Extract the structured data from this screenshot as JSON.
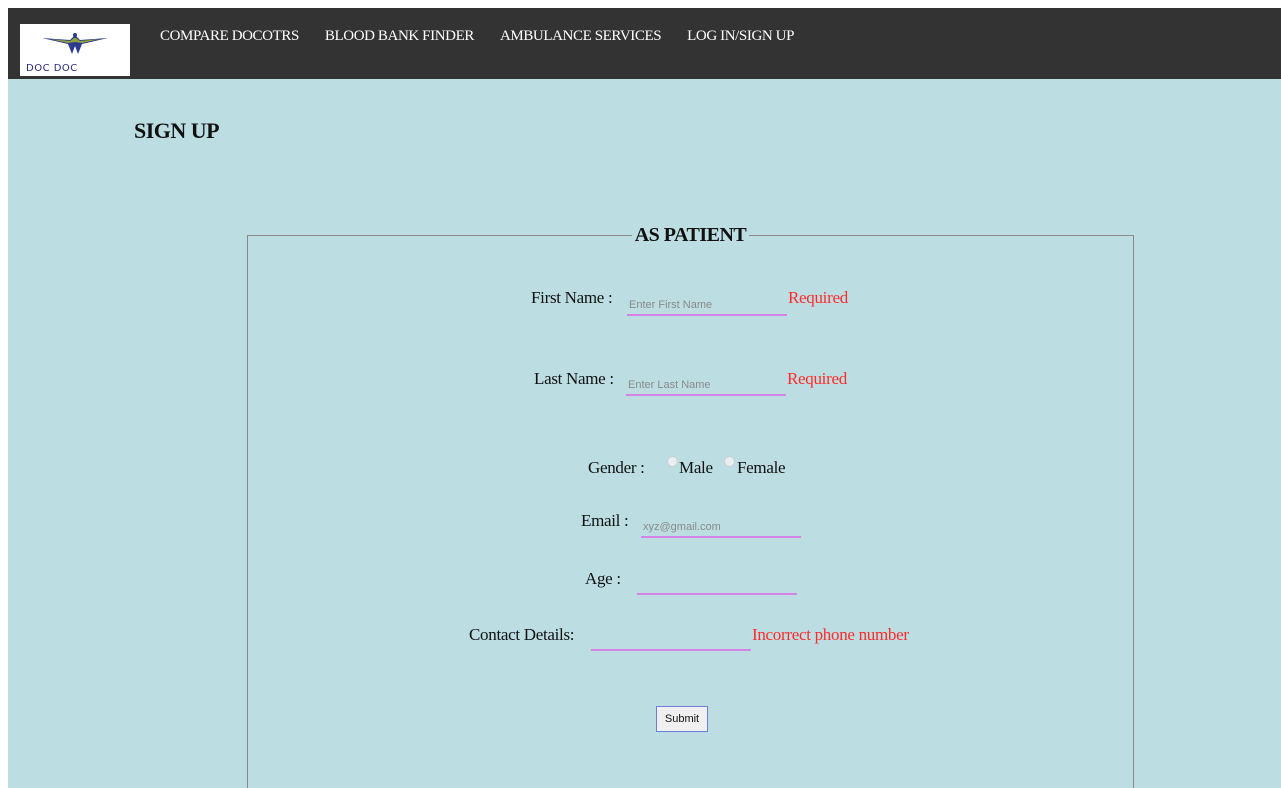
{
  "brand": {
    "logo_text": "DOC DOC",
    "logo_icon": "bird-emblem-icon"
  },
  "nav": {
    "items": [
      {
        "label": "COMPARE DOCOTRS"
      },
      {
        "label": "BLOOD BANK FINDER"
      },
      {
        "label": "AMBULANCE SERVICES"
      },
      {
        "label": "LOG IN/SIGN UP"
      }
    ]
  },
  "page": {
    "title": "SIGN UP"
  },
  "form": {
    "legend": "AS PATIENT",
    "first_name": {
      "label": "First Name :",
      "placeholder": "Enter First Name",
      "value": "",
      "error": "Required"
    },
    "last_name": {
      "label": "Last Name :",
      "placeholder": "Enter Last Name",
      "value": "",
      "error": "Required"
    },
    "gender": {
      "label": "Gender :",
      "options": [
        "Male",
        "Female"
      ],
      "selected": null
    },
    "email": {
      "label": "Email :",
      "placeholder": "xyz@gmail.com",
      "value": ""
    },
    "age": {
      "label": "Age :",
      "placeholder": "",
      "value": ""
    },
    "contact": {
      "label": "Contact Details:",
      "placeholder": "",
      "value": "",
      "error": "Incorrect phone number"
    },
    "submit_label": "Submit"
  },
  "colors": {
    "navbar": "#333333",
    "background": "#bcdee3",
    "input_underline": "#d583e8",
    "error": "#ff2a2a"
  }
}
